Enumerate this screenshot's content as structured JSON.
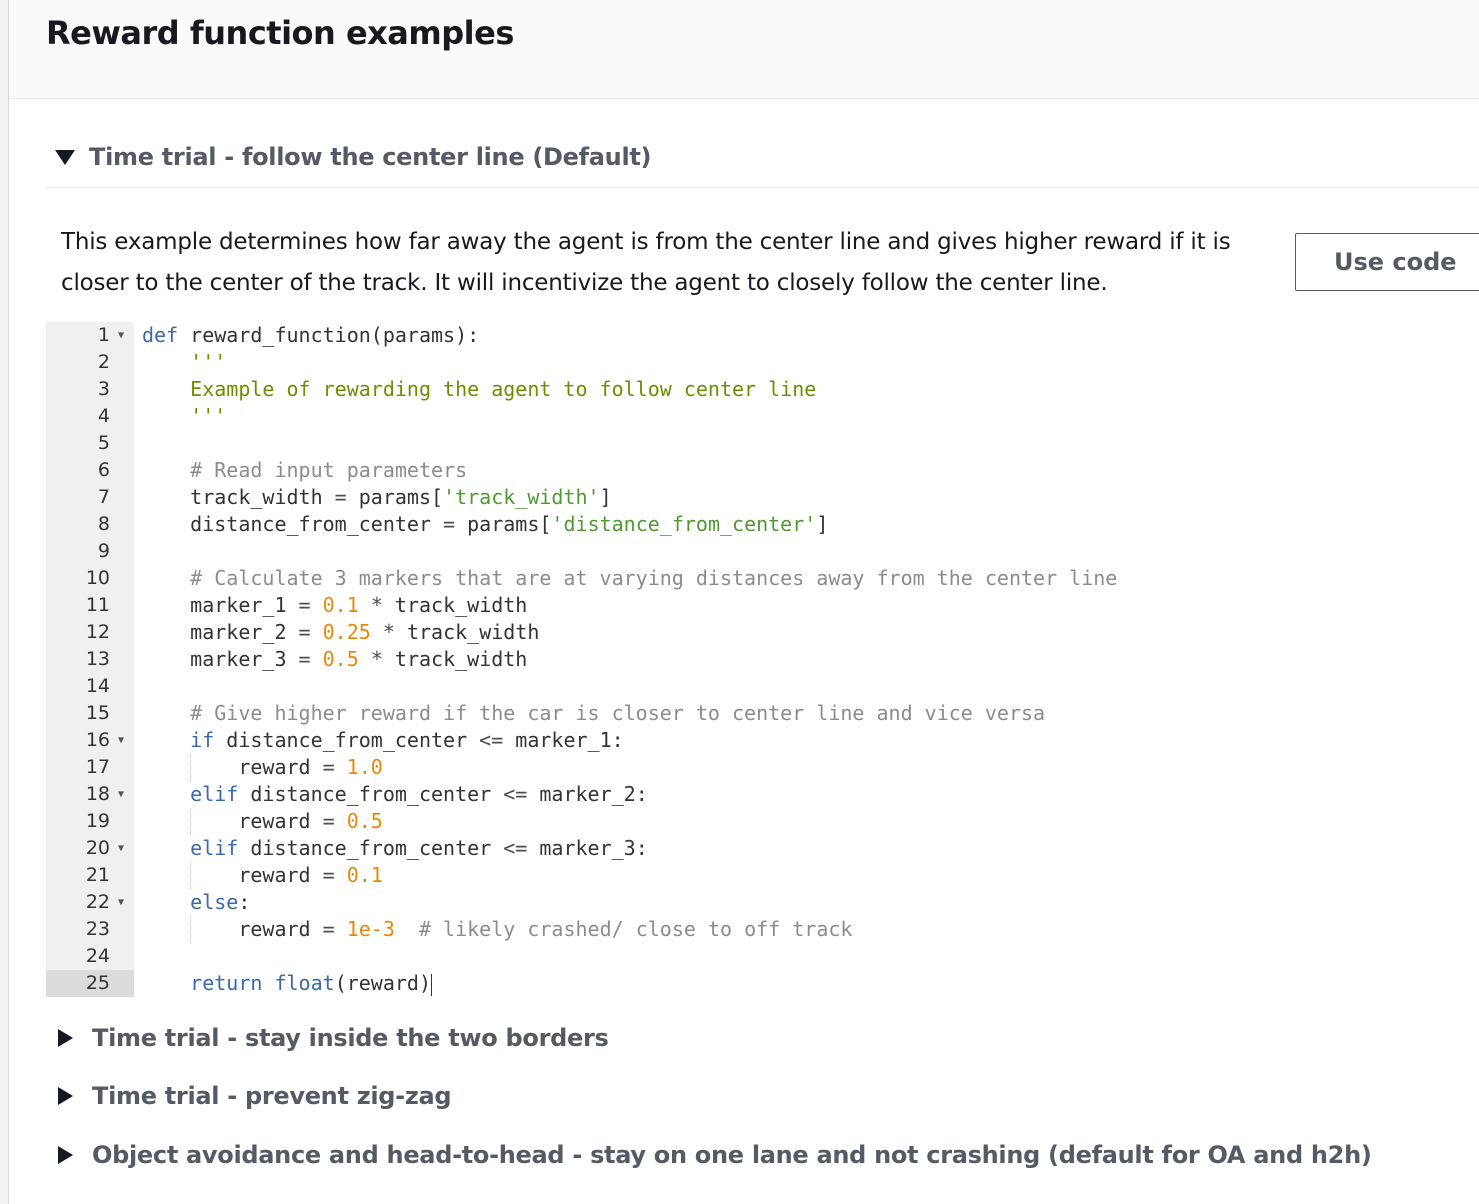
{
  "header": {
    "title": "Reward function examples"
  },
  "expanded_section": {
    "title": "Time trial - follow the center line (Default)",
    "description": "This example determines how far away the agent is from the center line and gives higher reward if it is closer to the center of the track. It will incentivize the agent to closely follow the center line.",
    "use_code_label": "Use code"
  },
  "code_lines": [
    {
      "n": "1",
      "fold": true,
      "tokens": [
        {
          "t": "def",
          "c": "kw"
        },
        {
          "t": " reward_function(params):",
          "c": ""
        }
      ]
    },
    {
      "n": "2",
      "fold": false,
      "tokens": [
        {
          "t": "    '''",
          "c": "doc"
        }
      ]
    },
    {
      "n": "3",
      "fold": false,
      "tokens": [
        {
          "t": "    Example of rewarding the agent to follow center line",
          "c": "doc"
        }
      ]
    },
    {
      "n": "4",
      "fold": false,
      "tokens": [
        {
          "t": "    '''",
          "c": "doc"
        }
      ]
    },
    {
      "n": "5",
      "fold": false,
      "tokens": []
    },
    {
      "n": "6",
      "fold": false,
      "tokens": [
        {
          "t": "    # Read input parameters",
          "c": "cm"
        }
      ]
    },
    {
      "n": "7",
      "fold": false,
      "tokens": [
        {
          "t": "    track_width ",
          "c": ""
        },
        {
          "t": "=",
          "c": "op"
        },
        {
          "t": " params[",
          "c": ""
        },
        {
          "t": "'track_width'",
          "c": "str"
        },
        {
          "t": "]",
          "c": ""
        }
      ]
    },
    {
      "n": "8",
      "fold": false,
      "tokens": [
        {
          "t": "    distance_from_center ",
          "c": ""
        },
        {
          "t": "=",
          "c": "op"
        },
        {
          "t": " params[",
          "c": ""
        },
        {
          "t": "'distance_from_center'",
          "c": "str"
        },
        {
          "t": "]",
          "c": ""
        }
      ]
    },
    {
      "n": "9",
      "fold": false,
      "tokens": []
    },
    {
      "n": "10",
      "fold": false,
      "tokens": [
        {
          "t": "    # Calculate 3 markers that are at varying distances away from the center line",
          "c": "cm"
        }
      ]
    },
    {
      "n": "11",
      "fold": false,
      "tokens": [
        {
          "t": "    marker_1 ",
          "c": ""
        },
        {
          "t": "=",
          "c": "op"
        },
        {
          "t": " ",
          "c": ""
        },
        {
          "t": "0.1",
          "c": "num"
        },
        {
          "t": " ",
          "c": ""
        },
        {
          "t": "*",
          "c": "op"
        },
        {
          "t": " track_width",
          "c": ""
        }
      ]
    },
    {
      "n": "12",
      "fold": false,
      "tokens": [
        {
          "t": "    marker_2 ",
          "c": ""
        },
        {
          "t": "=",
          "c": "op"
        },
        {
          "t": " ",
          "c": ""
        },
        {
          "t": "0.25",
          "c": "num"
        },
        {
          "t": " ",
          "c": ""
        },
        {
          "t": "*",
          "c": "op"
        },
        {
          "t": " track_width",
          "c": ""
        }
      ]
    },
    {
      "n": "13",
      "fold": false,
      "tokens": [
        {
          "t": "    marker_3 ",
          "c": ""
        },
        {
          "t": "=",
          "c": "op"
        },
        {
          "t": " ",
          "c": ""
        },
        {
          "t": "0.5",
          "c": "num"
        },
        {
          "t": " ",
          "c": ""
        },
        {
          "t": "*",
          "c": "op"
        },
        {
          "t": " track_width",
          "c": ""
        }
      ]
    },
    {
      "n": "14",
      "fold": false,
      "tokens": []
    },
    {
      "n": "15",
      "fold": false,
      "tokens": [
        {
          "t": "    # Give higher reward if the car is closer to center line and vice versa",
          "c": "cm"
        }
      ]
    },
    {
      "n": "16",
      "fold": true,
      "tokens": [
        {
          "t": "    ",
          "c": ""
        },
        {
          "t": "if",
          "c": "kw"
        },
        {
          "t": " distance_from_center ",
          "c": ""
        },
        {
          "t": "<=",
          "c": "op"
        },
        {
          "t": " marker_1:",
          "c": ""
        }
      ]
    },
    {
      "n": "17",
      "fold": false,
      "guide": true,
      "tokens": [
        {
          "t": "        reward ",
          "c": ""
        },
        {
          "t": "=",
          "c": "op"
        },
        {
          "t": " ",
          "c": ""
        },
        {
          "t": "1.0",
          "c": "num"
        }
      ]
    },
    {
      "n": "18",
      "fold": true,
      "tokens": [
        {
          "t": "    ",
          "c": ""
        },
        {
          "t": "elif",
          "c": "kw"
        },
        {
          "t": " distance_from_center ",
          "c": ""
        },
        {
          "t": "<=",
          "c": "op"
        },
        {
          "t": " marker_2:",
          "c": ""
        }
      ]
    },
    {
      "n": "19",
      "fold": false,
      "guide": true,
      "tokens": [
        {
          "t": "        reward ",
          "c": ""
        },
        {
          "t": "=",
          "c": "op"
        },
        {
          "t": " ",
          "c": ""
        },
        {
          "t": "0.5",
          "c": "num"
        }
      ]
    },
    {
      "n": "20",
      "fold": true,
      "tokens": [
        {
          "t": "    ",
          "c": ""
        },
        {
          "t": "elif",
          "c": "kw"
        },
        {
          "t": " distance_from_center ",
          "c": ""
        },
        {
          "t": "<=",
          "c": "op"
        },
        {
          "t": " marker_3:",
          "c": ""
        }
      ]
    },
    {
      "n": "21",
      "fold": false,
      "guide": true,
      "tokens": [
        {
          "t": "        reward ",
          "c": ""
        },
        {
          "t": "=",
          "c": "op"
        },
        {
          "t": " ",
          "c": ""
        },
        {
          "t": "0.1",
          "c": "num"
        }
      ]
    },
    {
      "n": "22",
      "fold": true,
      "tokens": [
        {
          "t": "    ",
          "c": ""
        },
        {
          "t": "else",
          "c": "kw"
        },
        {
          "t": ":",
          "c": ""
        }
      ]
    },
    {
      "n": "23",
      "fold": false,
      "guide": true,
      "tokens": [
        {
          "t": "        reward ",
          "c": ""
        },
        {
          "t": "=",
          "c": "op"
        },
        {
          "t": " ",
          "c": ""
        },
        {
          "t": "1e-3",
          "c": "num"
        },
        {
          "t": "  # likely crashed/ close to off track",
          "c": "cm"
        }
      ]
    },
    {
      "n": "24",
      "fold": false,
      "tokens": []
    },
    {
      "n": "25",
      "fold": false,
      "active": true,
      "tokens": [
        {
          "t": "    ",
          "c": ""
        },
        {
          "t": "return",
          "c": "kw"
        },
        {
          "t": " ",
          "c": ""
        },
        {
          "t": "float",
          "c": "kw"
        },
        {
          "t": "(reward)",
          "c": ""
        }
      ]
    }
  ],
  "collapsed_sections": [
    {
      "title": "Time trial - stay inside the two borders"
    },
    {
      "title": "Time trial - prevent zig-zag"
    },
    {
      "title": "Object avoidance and head-to-head - stay on one lane and not crashing (default for OA and h2h)"
    }
  ],
  "colors": {
    "keyword": "#3b6aa8",
    "string": "#4f9a2f",
    "number": "#e8890c",
    "comment": "#8c8c8c",
    "section_title": "#545b64"
  },
  "icons": {
    "expanded": "caret-down-icon",
    "collapsed": "caret-right-icon",
    "fold": "fold-arrow-icon"
  }
}
